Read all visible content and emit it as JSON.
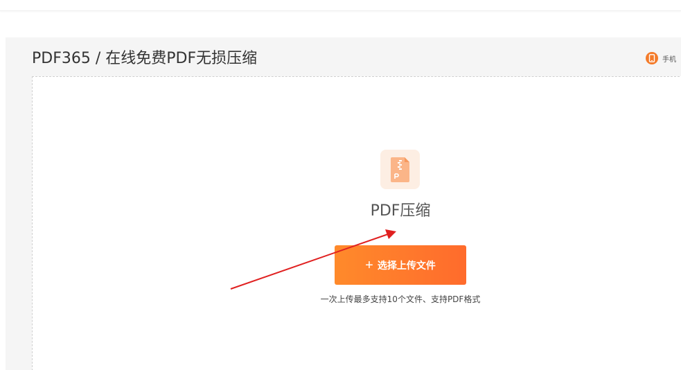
{
  "header": {
    "title": "PDF365 / 在线免费PDF无损压缩",
    "mobile_link": {
      "label": "手机",
      "icon": "mobile-phone-icon"
    }
  },
  "tool": {
    "icon": "pdf-compress-icon",
    "title": "PDF压缩"
  },
  "upload": {
    "button_label": "选择上传文件",
    "button_icon": "plus-icon",
    "hint": "一次上传最多支持10个文件、支持PDF格式"
  },
  "colors": {
    "accent": "#ff7a2b",
    "icon_bg": "#fdeee3",
    "annotation": "#e02020"
  }
}
